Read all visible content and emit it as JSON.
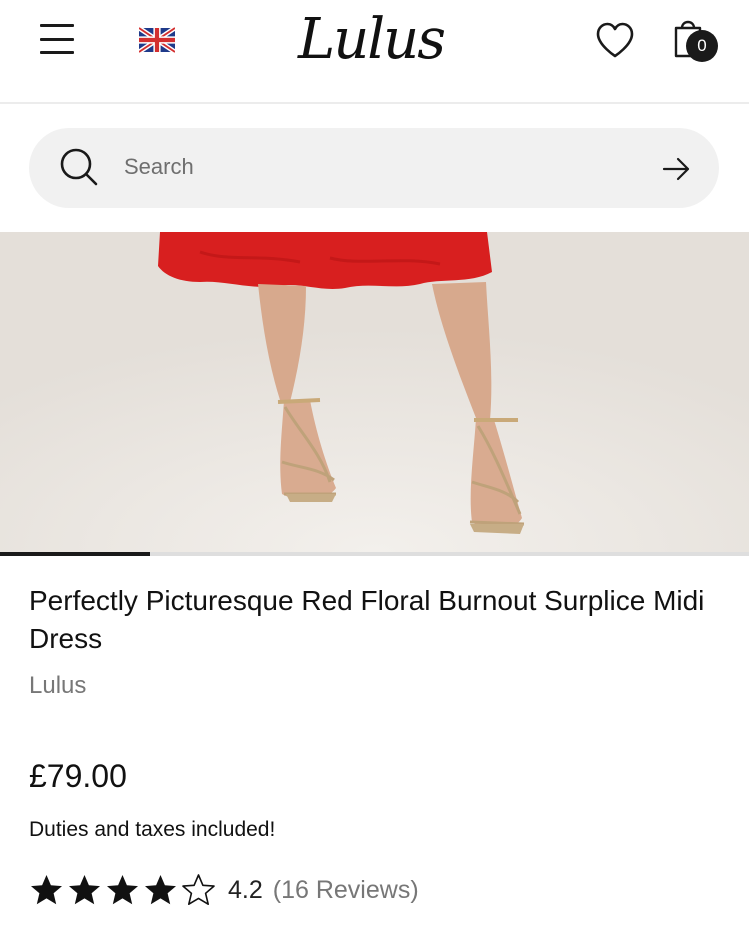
{
  "header": {
    "brand_name": "Lulus",
    "flag_name": "uk-flag-icon",
    "bag_count": "0"
  },
  "search": {
    "placeholder": "Search"
  },
  "gallery": {
    "progress": 0.2
  },
  "product": {
    "title": "Perfectly Picturesque Red Floral Burnout Surplice Midi Dress",
    "brand": "Lulus",
    "price": "£79.00",
    "duties_note": "Duties and taxes included!",
    "rating_value": "4.2",
    "rating_stars": 4.2,
    "reviews_label": "(16 Reviews)"
  },
  "colors": {
    "text": "#111111",
    "muted": "#777777",
    "search_bg": "#f1f1f1",
    "dress_red": "#d81f1f"
  }
}
